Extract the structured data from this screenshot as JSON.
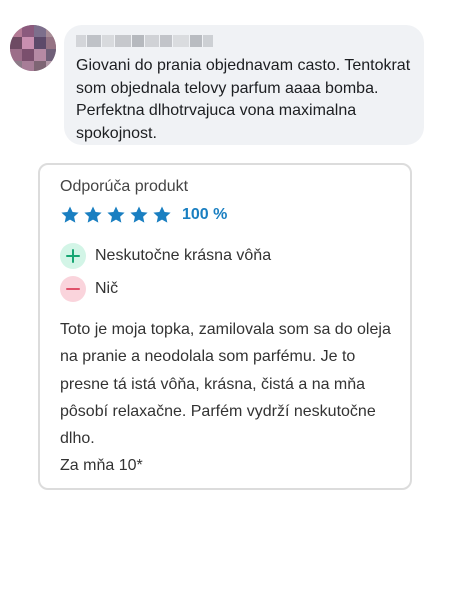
{
  "comment": {
    "author_name": "",
    "text": "Giovani do prania objednavam casto. Tentokrat som objednala telovy parfum aaaa bomba. Perfektna dlhotrvajuca vona maximalna spokojnost."
  },
  "review": {
    "recommend_label": "Odporúča produkt",
    "rating_stars": 5,
    "rating_max": 5,
    "rating_percent_label": "100 %",
    "pro": {
      "icon": "plus-icon",
      "text": "Neskutočne krásna vôňa"
    },
    "con": {
      "icon": "minus-icon",
      "text": "Nič"
    },
    "body": "Toto je moja topka, zamilovala som sa do oleja na pranie a neodolala som parfému. Je to presne tá istá vôňa, krásna, čistá a na mňa pôsobí relaxačne. Parfém vydrží neskutočne dlho.\nZa mňa 10*"
  },
  "colors": {
    "star": "#1a7fc1",
    "rating_text": "#1a7fc1",
    "pro_bg": "#d3f5e7",
    "pro_icon": "#17a673",
    "con_bg": "#fad4dc",
    "con_icon": "#e0516a",
    "bubble_bg": "#f0f2f5",
    "card_border": "#dcdcdc"
  }
}
